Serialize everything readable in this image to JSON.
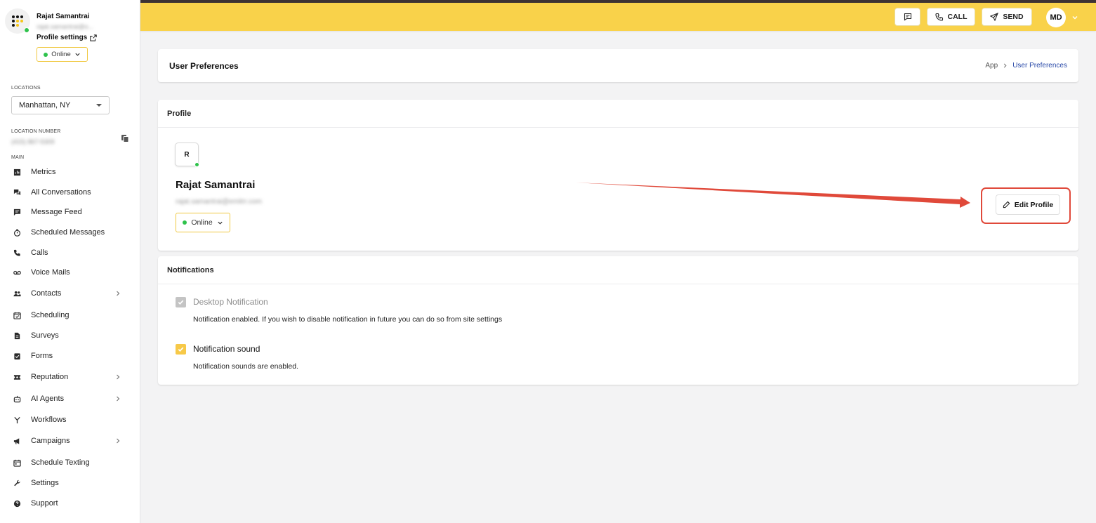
{
  "user": {
    "name": "Rajat Samantrai",
    "email_truncated": "rajat.samantrai@o...",
    "profile_settings_label": "Profile settings",
    "status": "Online"
  },
  "sidebar": {
    "locations_label": "LOCATIONS",
    "location_value": "Manhattan, NY",
    "location_number_label": "LOCATION NUMBER",
    "location_number_value": "(415) 867-5309",
    "main_label": "MAIN",
    "items": [
      {
        "label": "Metrics",
        "icon": "bar-chart-icon",
        "has_arrow": false
      },
      {
        "label": "All Conversations",
        "icon": "chat-bubbles-icon",
        "has_arrow": false
      },
      {
        "label": "Message Feed",
        "icon": "message-icon",
        "has_arrow": false
      },
      {
        "label": "Scheduled Messages",
        "icon": "timer-icon",
        "has_arrow": false
      },
      {
        "label": "Calls",
        "icon": "phone-icon",
        "has_arrow": false
      },
      {
        "label": "Voice Mails",
        "icon": "voicemail-icon",
        "has_arrow": false
      },
      {
        "label": "Contacts",
        "icon": "people-icon",
        "has_arrow": true
      },
      {
        "label": "Scheduling",
        "icon": "calendar-check-icon",
        "has_arrow": false
      },
      {
        "label": "Surveys",
        "icon": "document-icon",
        "has_arrow": false
      },
      {
        "label": "Forms",
        "icon": "clipboard-check-icon",
        "has_arrow": false
      },
      {
        "label": "Reputation",
        "icon": "ticket-star-icon",
        "has_arrow": true
      },
      {
        "label": "AI Agents",
        "icon": "robot-icon",
        "has_arrow": true
      },
      {
        "label": "Workflows",
        "icon": "fork-icon",
        "has_arrow": false
      },
      {
        "label": "Campaigns",
        "icon": "megaphone-icon",
        "has_arrow": true
      },
      {
        "label": "Schedule Texting",
        "icon": "calendar-icon",
        "has_arrow": false
      },
      {
        "label": "Settings",
        "icon": "wrench-icon",
        "has_arrow": false
      },
      {
        "label": "Support",
        "icon": "help-icon",
        "has_arrow": false
      }
    ]
  },
  "topbar": {
    "call_label": "CALL",
    "send_label": "SEND",
    "avatar_initials": "MD",
    "accent_color": "#f9d24a"
  },
  "header": {
    "title": "User Preferences",
    "breadcrumb": [
      "App",
      "User Preferences"
    ]
  },
  "profile": {
    "section_title": "Profile",
    "avatar_initial": "R",
    "name": "Rajat Samantrai",
    "email": "rajat.samantrai@emitrr.com",
    "status": "Online",
    "edit_button_label": "Edit Profile"
  },
  "notifications": {
    "section_title": "Notifications",
    "desktop": {
      "label": "Desktop Notification",
      "checked": true,
      "disabled": true,
      "description": "Notification enabled. If you wish to disable notification in future you can do so from site settings"
    },
    "sound": {
      "label": "Notification sound",
      "checked": true,
      "description": "Notification sounds are enabled."
    }
  }
}
